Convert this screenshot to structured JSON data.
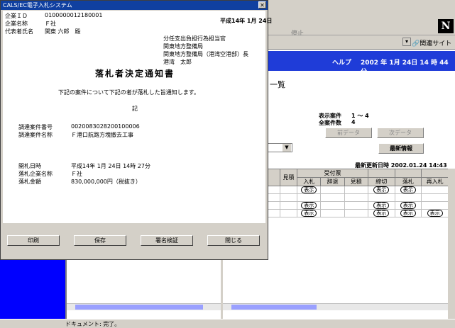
{
  "background": {
    "logo": "N",
    "stop_label": "停止",
    "related_sites": "関連サイト",
    "help": "ヘルプ",
    "datetime": "2002 年 1月 24日 14 時 44 分",
    "page_heading": "一覧",
    "display_items_label": "表示案件",
    "display_items_value": "1 ～ 4",
    "total_items_label": "全案件数",
    "total_items_value": "4",
    "prev_button": "前データ",
    "next_button": "次データ",
    "latest_button": "最新情報",
    "last_updated": "最新更新日時 2002.01.24 14:43",
    "table": {
      "col_estimate": "見積",
      "group_receipt": "受付票",
      "cols": [
        "入札",
        "辞退",
        "見積",
        "締切",
        "落札",
        "再入札"
      ],
      "pill_label": "表示"
    },
    "status_text": "ドキュメント: 完了。"
  },
  "dialog": {
    "title": "CALS/EC電子入札システム",
    "company_id_label": "企業ＩＤ",
    "company_id_value": "0100000012180001",
    "company_name_label": "企業名称",
    "company_name_value": "Ｆ社",
    "rep_label": "代表者氏名",
    "rep_value": "関東 六郎　殿",
    "date": "平成14年 1月 24日",
    "issuer_line1": "分任支出負担行為担当官",
    "issuer_line2": "関東地方整備局",
    "issuer_line3": "関東地方整備局（港湾空港部）長",
    "issuer_line4": "港湾　太郎",
    "doc_title": "落札者決定通知書",
    "body_text": "下記の案件について下記の者が落札した旨通知します。",
    "ki": "記",
    "procurement_no_label": "調達案件番号",
    "procurement_no_value": "0020083028200100006",
    "procurement_name_label": "調達案件名称",
    "procurement_name_value": "Ｆ港口航路方塊撤去工事",
    "opening_date_label": "開札日時",
    "opening_date_value": "平成14年 1月 24日 14時 27分",
    "winner_label": "落札企業名称",
    "winner_value": "Ｆ社",
    "amount_label": "落札金額",
    "amount_value": "830,000,000円（税抜き）",
    "buttons": {
      "print": "印刷",
      "save": "保存",
      "verify": "署名検証",
      "close": "閉じる"
    }
  }
}
